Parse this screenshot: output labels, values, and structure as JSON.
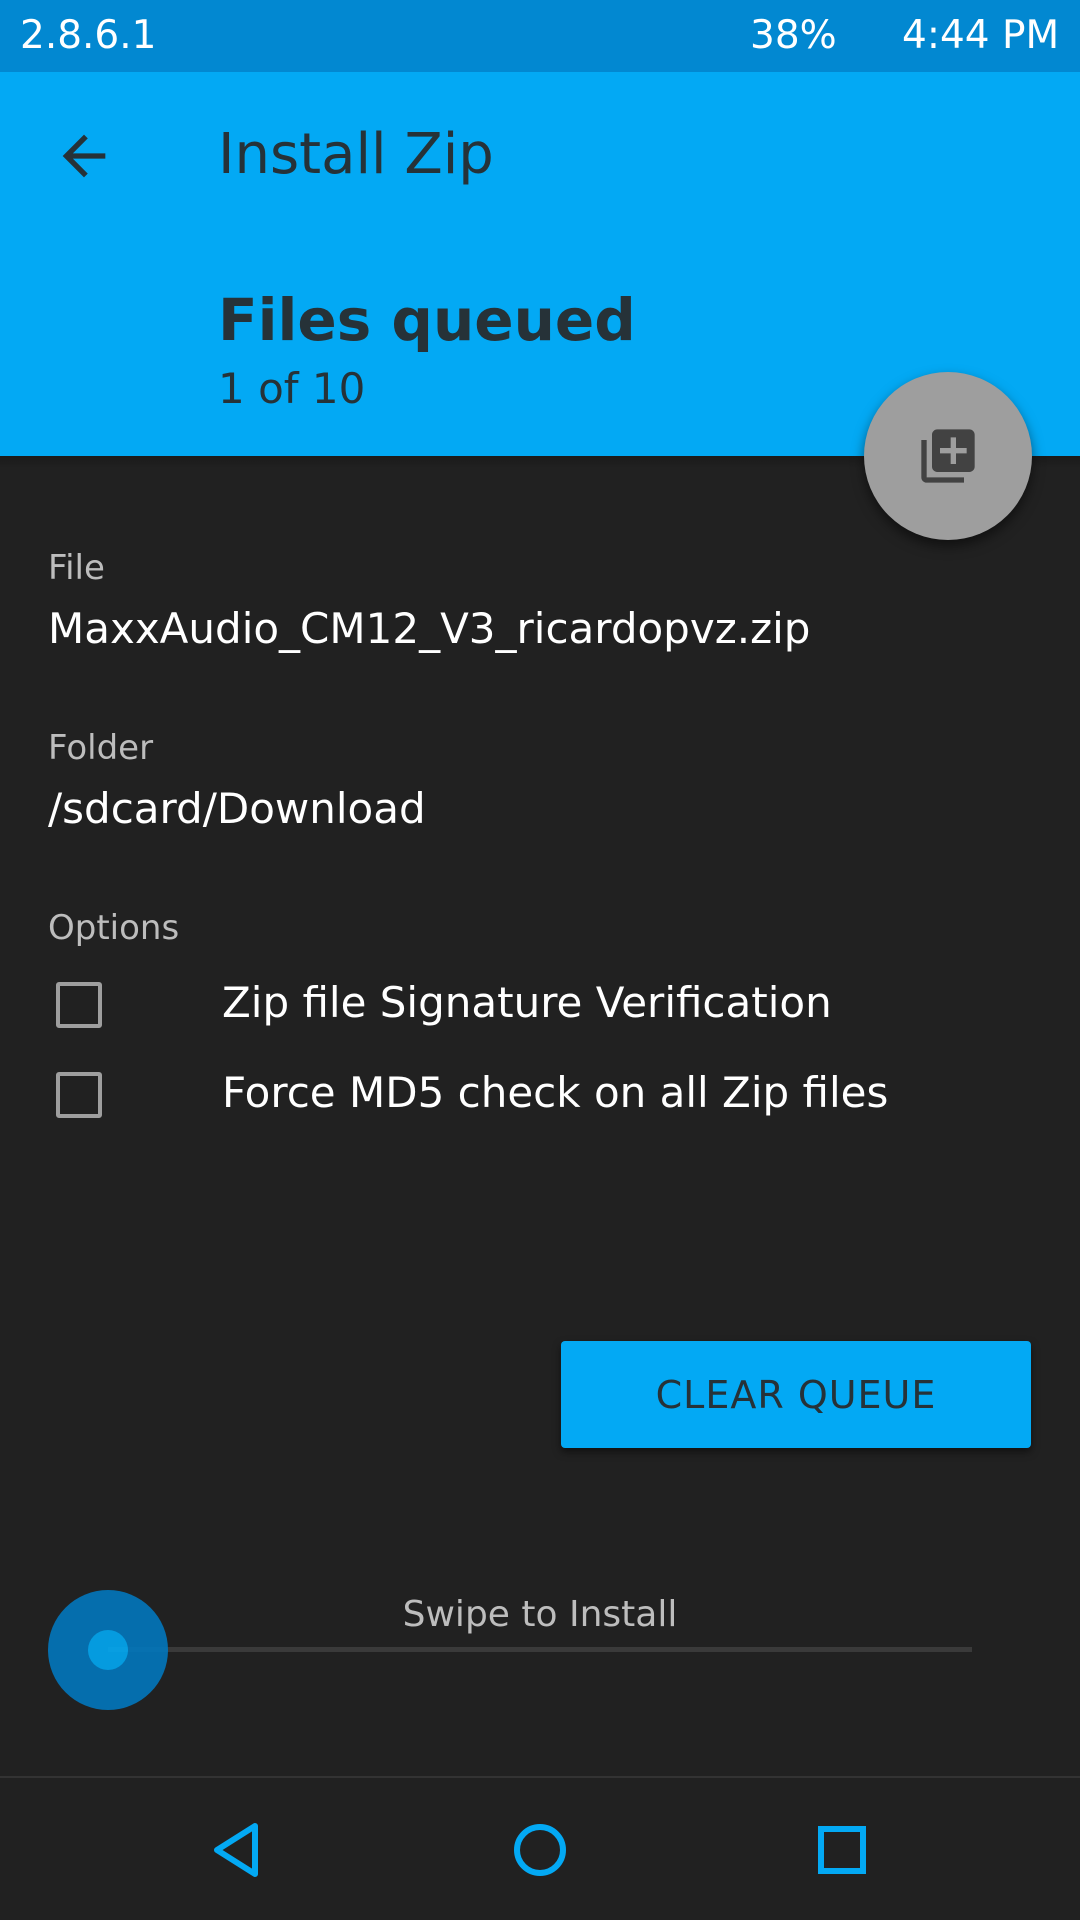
{
  "status_bar": {
    "version": "2.8.6.1",
    "battery": "38%",
    "time": "4:44 PM"
  },
  "header": {
    "title": "Install Zip",
    "subtitle": "Files queued",
    "queue_count": "1 of 10",
    "back_icon": "arrow-left-icon",
    "fab_icon": "library-add-icon"
  },
  "file": {
    "label": "File",
    "value": "MaxxAudio_CM12_V3_ricardopvz.zip"
  },
  "folder": {
    "label": "Folder",
    "value": "/sdcard/Download"
  },
  "options": {
    "label": "Options",
    "items": [
      {
        "label": "Zip file Signature Verification",
        "checked": false
      },
      {
        "label": "Force MD5 check on all Zip files",
        "checked": false
      }
    ]
  },
  "actions": {
    "clear_queue": "CLEAR QUEUE"
  },
  "swipe": {
    "label": "Swipe to Install",
    "progress": 0
  },
  "nav": {
    "back_icon": "triangle-back-icon",
    "home_icon": "circle-home-icon",
    "recents_icon": "square-recents-icon"
  },
  "colors": {
    "accent": "#03a9f4",
    "status_bar": "#0288d1",
    "background": "#212121",
    "header_text": "#263238"
  }
}
